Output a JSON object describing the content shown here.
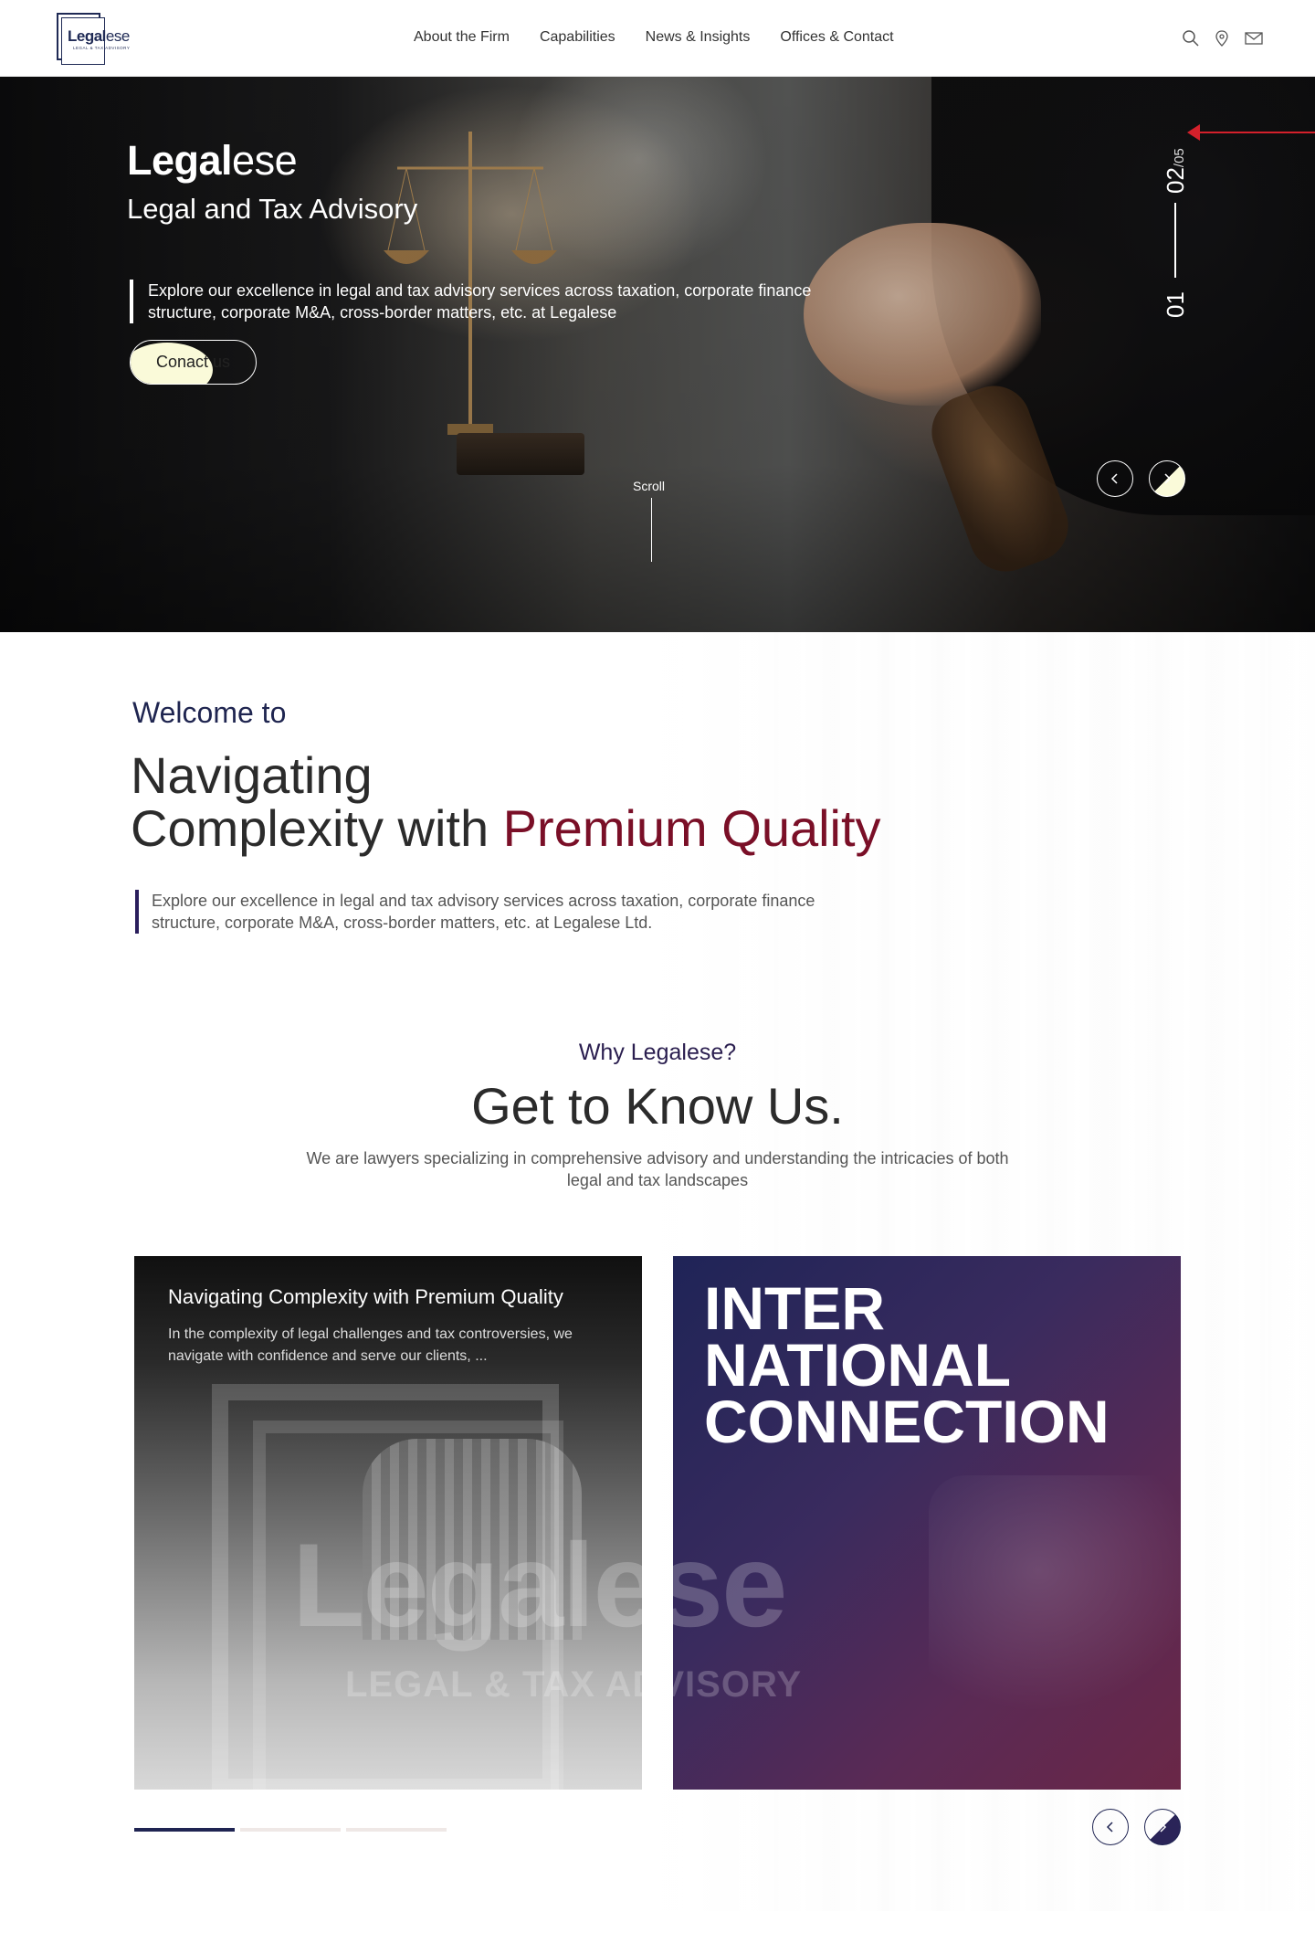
{
  "header": {
    "logo": {
      "brand_bold": "Legal",
      "brand_light": "ese",
      "tagline": "LEGAL & TAX ADVISORY"
    },
    "nav": [
      "About the Firm",
      "Capabilities",
      "News & Insights",
      "Offices & Contact"
    ],
    "icons": [
      "search-icon",
      "location-pin-icon",
      "mail-icon"
    ]
  },
  "hero": {
    "title_bold": "Legal",
    "title_light": "ese",
    "subtitle": "Legal and Tax Advisory",
    "description": "Explore our excellence in legal and tax advisory services across taxation, corporate finance structure, corporate M&A, cross-border matters, etc. at Legalese",
    "cta": "Conact us",
    "counter_current": "02",
    "counter_total": "/05",
    "counter_start": "01",
    "scroll_label": "Scroll",
    "prev_icon": "chevron-left-icon",
    "next_icon": "chevron-right-icon",
    "accent_color": "#fafad9"
  },
  "welcome": {
    "kicker": "Welcome to",
    "heading_line1": "Navigating",
    "heading_line2_plain": "Complexity with ",
    "heading_line2_accent": "Premium Quality",
    "description": "Explore our excellence in legal and tax advisory services across taxation, corporate finance structure, corporate M&A, cross-border matters, etc. at Legalese Ltd.",
    "accent_color": "#7a0f27"
  },
  "about": {
    "kicker": "Why Legalese?",
    "heading": "Get to Know Us.",
    "description": "We are lawyers specializing in comprehensive advisory and understanding the intricacies of both legal and tax landscapes"
  },
  "cards": [
    {
      "title": "Navigating Complexity with Premium Quality",
      "description": "In the complexity of legal challenges and tax controversies, we navigate with confidence and serve our clients, ...",
      "watermark": "Legalese",
      "watermark_sub": "LEGAL & TAX ADVISORY"
    },
    {
      "title": "INTER NATIONAL CONNECTION"
    }
  ],
  "carousel": {
    "slides": 3,
    "active_index": 0,
    "active_color": "#1f2452"
  }
}
